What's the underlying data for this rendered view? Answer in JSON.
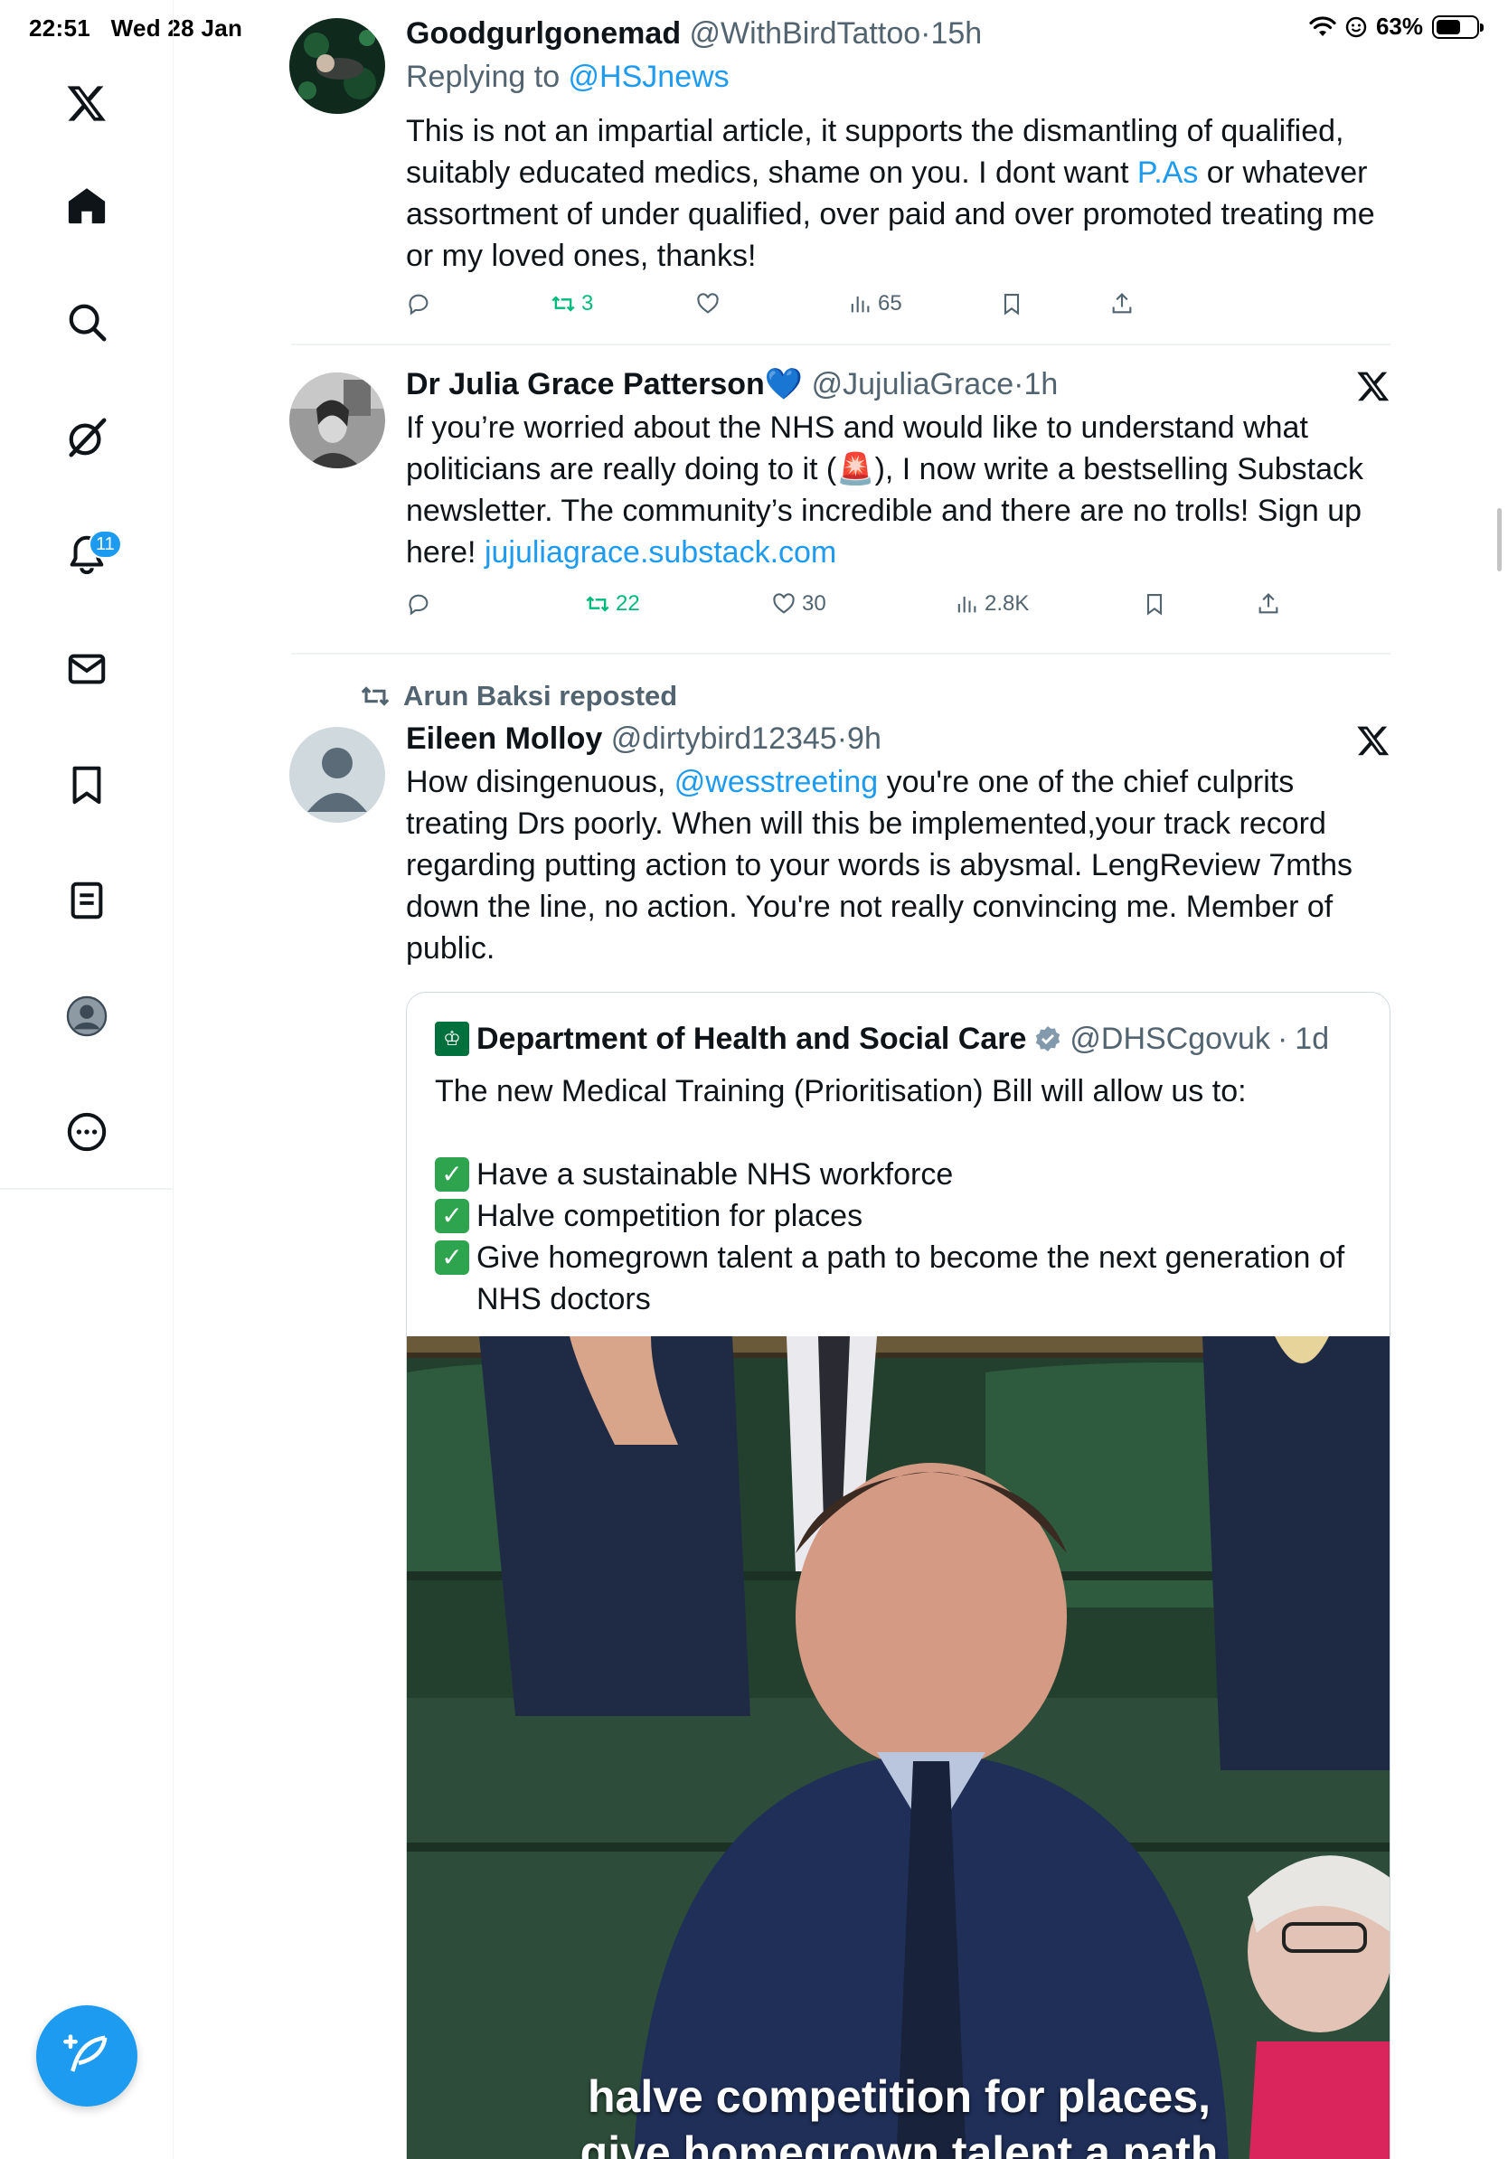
{
  "status_bar": {
    "time": "22:51",
    "date": "Wed 28 Jan",
    "battery_percent": "63%",
    "battery_level": 0.63
  },
  "sidebar": {
    "items": [
      {
        "icon": "x-logo-icon"
      },
      {
        "icon": "home-icon"
      },
      {
        "icon": "search-icon"
      },
      {
        "icon": "grok-icon"
      },
      {
        "icon": "notifications-bell-icon",
        "badge": "11"
      },
      {
        "icon": "messages-envelope-icon"
      },
      {
        "icon": "bookmark-icon"
      },
      {
        "icon": "lists-icon"
      },
      {
        "icon": "profile-avatar-icon"
      },
      {
        "icon": "more-circle-icon"
      }
    ],
    "compose_icon": "compose-feather-icon"
  },
  "tweets": [
    {
      "name": "Goodgurlgonemad",
      "handle": "@WithBirdTattoo",
      "time": "15h",
      "replying_prefix": "Replying to ",
      "replying_to": "@HSJnews",
      "text_1": "This is not an impartial article, it supports the dismantling of qualified, suitably educated medics, shame on you. I dont want ",
      "text_link": "P.As",
      "text_2": " or whatever assortment of under qualified, over paid and over promoted treating me or my loved ones, thanks!",
      "retweets": "3",
      "likes": "",
      "views": "65"
    },
    {
      "name": "Dr Julia Grace Patterson",
      "name_emoji": "💙",
      "handle": "@JujuliaGrace",
      "time": "1h",
      "text_1": "If you’re worried about the NHS and would like to understand what politicians are really doing to it (",
      "text_emoji": "🚨",
      "text_2": "), I now write a bestselling Substack newsletter. The community’s incredible and there are no trolls! Sign up here! ",
      "text_link": "jujuliagrace.substack.com",
      "retweets": "22",
      "likes": "30",
      "views": "2.8K"
    },
    {
      "reposted_by": "Arun Baksi reposted",
      "name": "Eileen Molloy",
      "handle": "@dirtybird12345",
      "time": "9h",
      "text_1": "How disingenuous,  ",
      "text_link": "@wesstreeting",
      "text_2": " you're one of the chief culprits treating Drs poorly. When will this be implemented,your track record regarding putting action to your words is abysmal. LengReview 7mths down the line, no action. You're not really convincing me. Member of public.",
      "quote": {
        "name": "Department of Health and Social Care",
        "handle": "@DHSCgovuk",
        "time": "1d",
        "intro": "The new Medical Training (Prioritisation) Bill will allow us to:",
        "checks": [
          "Have a sustainable NHS workforce",
          "Halve competition for places",
          "Give homegrown talent a path to become the next generation of NHS doctors"
        ],
        "video_caption_1": "halve competition for places,",
        "video_caption_2": "give homegrown talent a path"
      }
    }
  ],
  "separator_dot": "·"
}
